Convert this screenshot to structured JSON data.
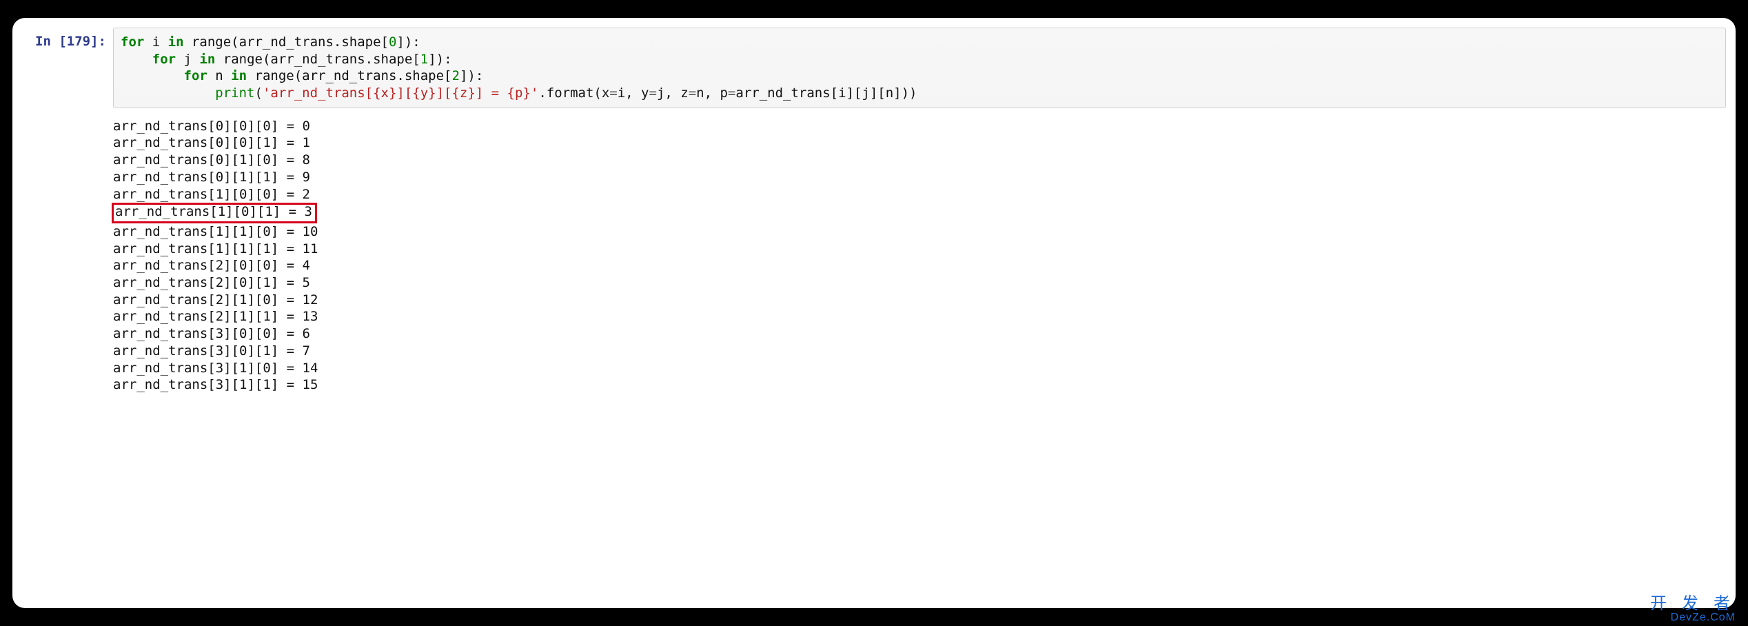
{
  "cell": {
    "prompt_prefix": "In [",
    "prompt_num": "179",
    "prompt_suffix": "]:"
  },
  "code": {
    "kw_for1": "for",
    "var_i": " i ",
    "kw_in1": "in",
    "txt_range1": " range(arr_nd_trans.shape[",
    "num0": "0",
    "txt_range1_end": "]):",
    "indent2": "    ",
    "kw_for2": "for",
    "var_j": " j ",
    "kw_in2": "in",
    "txt_range2": " range(arr_nd_trans.shape[",
    "num1": "1",
    "txt_range2_end": "]):",
    "indent3": "        ",
    "kw_for3": "for",
    "var_n": " n ",
    "kw_in3": "in",
    "txt_range3": " range(arr_nd_trans.shape[",
    "num2": "2",
    "txt_range3_end": "]):",
    "indent4": "            ",
    "fn_print": "print",
    "print_open": "(",
    "str_fmt": "'arr_nd_trans[{x}][{y}][{z}] = {p}'",
    "dot_format": ".format(x",
    "eq1": "=",
    "arg_i": "i, y",
    "eq2": "=",
    "arg_j": "j, z",
    "eq3": "=",
    "arg_n": "n, p",
    "eq4": "=",
    "arg_expr": "arr_nd_trans[i][j][n]))"
  },
  "output": {
    "lines": [
      "arr_nd_trans[0][0][0] = 0",
      "arr_nd_trans[0][0][1] = 1",
      "arr_nd_trans[0][1][0] = 8",
      "arr_nd_trans[0][1][1] = 9",
      "arr_nd_trans[1][0][0] = 2",
      "arr_nd_trans[1][0][1] = 3",
      "arr_nd_trans[1][1][0] = 10",
      "arr_nd_trans[1][1][1] = 11",
      "arr_nd_trans[2][0][0] = 4",
      "arr_nd_trans[2][0][1] = 5",
      "arr_nd_trans[2][1][0] = 12",
      "arr_nd_trans[2][1][1] = 13",
      "arr_nd_trans[3][0][0] = 6",
      "arr_nd_trans[3][0][1] = 7",
      "arr_nd_trans[3][1][0] = 14",
      "arr_nd_trans[3][1][1] = 15"
    ],
    "highlight_index": 5
  },
  "watermark": {
    "cn": "开 发 者",
    "en": "DevZe.CoM"
  }
}
